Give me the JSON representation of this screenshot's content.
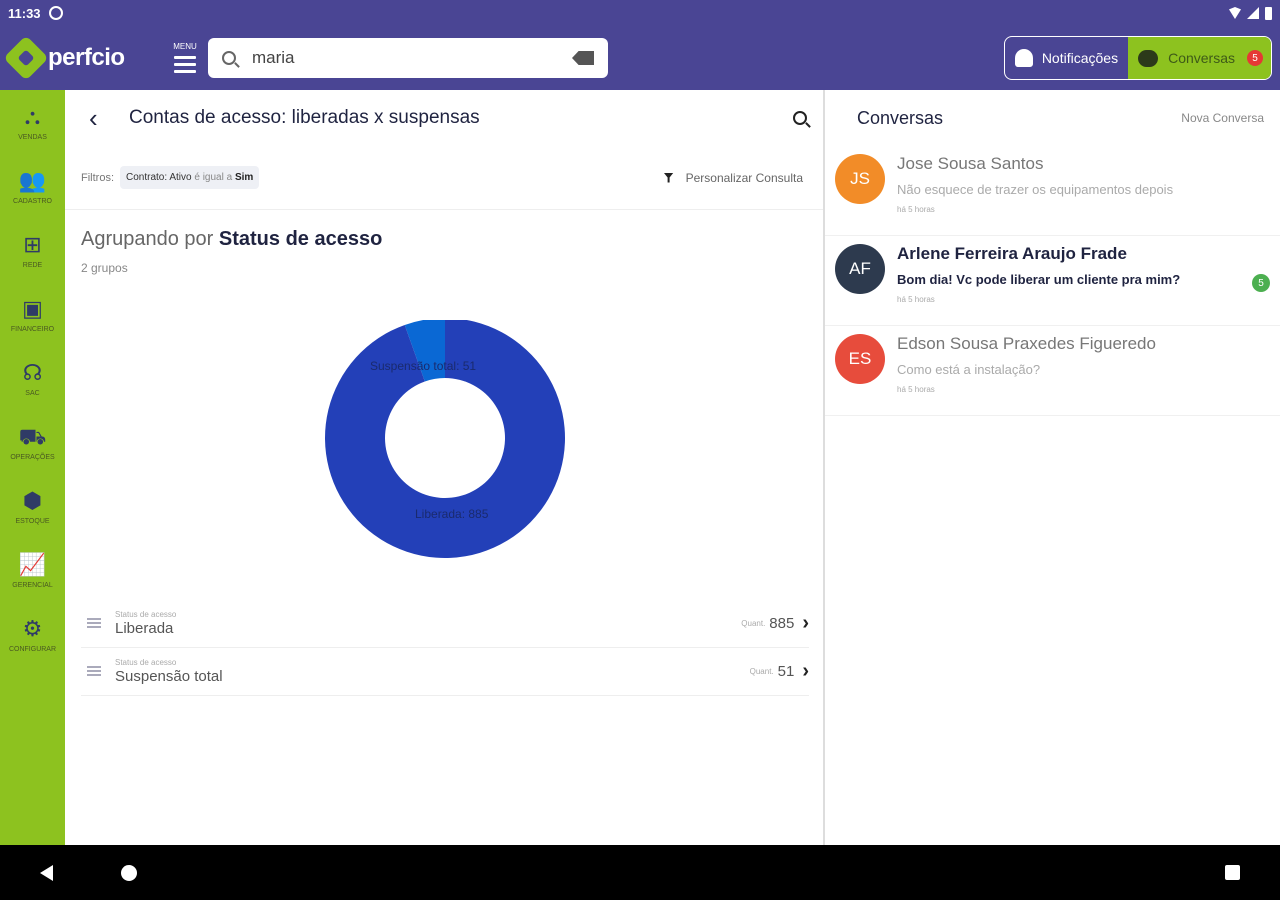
{
  "status_bar": {
    "time": "11:33"
  },
  "app_bar": {
    "logo_text": "perfcio",
    "menu_label": "MENU",
    "search_value": "maria",
    "notifications_label": "Notificações",
    "conversations_label": "Conversas",
    "conversations_badge": "5"
  },
  "sidebar": {
    "items": [
      {
        "label": "VENDAS",
        "icon": "handshake-icon",
        "glyph": "⛬"
      },
      {
        "label": "CADASTRO",
        "icon": "users-icon",
        "glyph": "👥"
      },
      {
        "label": "REDE",
        "icon": "network-icon",
        "glyph": "⊞"
      },
      {
        "label": "FINANCEIRO",
        "icon": "money-icon",
        "glyph": "▣"
      },
      {
        "label": "SAC",
        "icon": "headset-icon",
        "glyph": "☊"
      },
      {
        "label": "OPERAÇÕES",
        "icon": "car-icon",
        "glyph": "⛟"
      },
      {
        "label": "ESTOQUE",
        "icon": "box-icon",
        "glyph": "⬢"
      },
      {
        "label": "GERENCIAL",
        "icon": "chart-icon",
        "glyph": "📈"
      },
      {
        "label": "CONFIGURAR",
        "icon": "gear-icon",
        "glyph": "⚙"
      }
    ]
  },
  "main": {
    "title": "Contas de acesso: liberadas x suspensas",
    "filters_label": "Filtros:",
    "filter_chip": {
      "field": "Contrato: Ativo",
      "op": "é igual a",
      "value": "Sim"
    },
    "customize_label": "Personalizar Consulta",
    "grouping_prefix": "Agrupando por",
    "grouping_field": "Status de acesso",
    "group_count": "2 grupos",
    "rows": [
      {
        "caption": "Status de acesso",
        "value": "Liberada",
        "qty_label": "Quant.",
        "qty": "885"
      },
      {
        "caption": "Status de acesso",
        "value": "Suspensão total",
        "qty_label": "Quant.",
        "qty": "51"
      }
    ]
  },
  "chart_data": {
    "type": "pie",
    "variant": "donut",
    "categories": [
      "Liberada",
      "Suspensão total"
    ],
    "values": [
      885,
      51
    ],
    "labels": [
      "Liberada: 885",
      "Suspensão total: 51"
    ],
    "colors": [
      "#2340b8",
      "#0a68d4"
    ]
  },
  "conversations": {
    "title": "Conversas",
    "new_label": "Nova Conversa",
    "items": [
      {
        "initials": "JS",
        "color": "#f28c28",
        "name": "Jose Sousa Santos",
        "message": "Não esquece de trazer os equipamentos depois",
        "time": "há 5 horas",
        "unread": false,
        "badge": ""
      },
      {
        "initials": "AF",
        "color": "#2d3a4e",
        "name": "Arlene Ferreira Araujo Frade",
        "message": "Bom dia! Vc pode liberar um cliente pra mim?",
        "time": "há 5 horas",
        "unread": true,
        "badge": "5"
      },
      {
        "initials": "ES",
        "color": "#e74c3c",
        "name": "Edson Sousa Praxedes Figueredo",
        "message": "Como está a instalação?",
        "time": "há 5 horas",
        "unread": false,
        "badge": ""
      }
    ]
  }
}
